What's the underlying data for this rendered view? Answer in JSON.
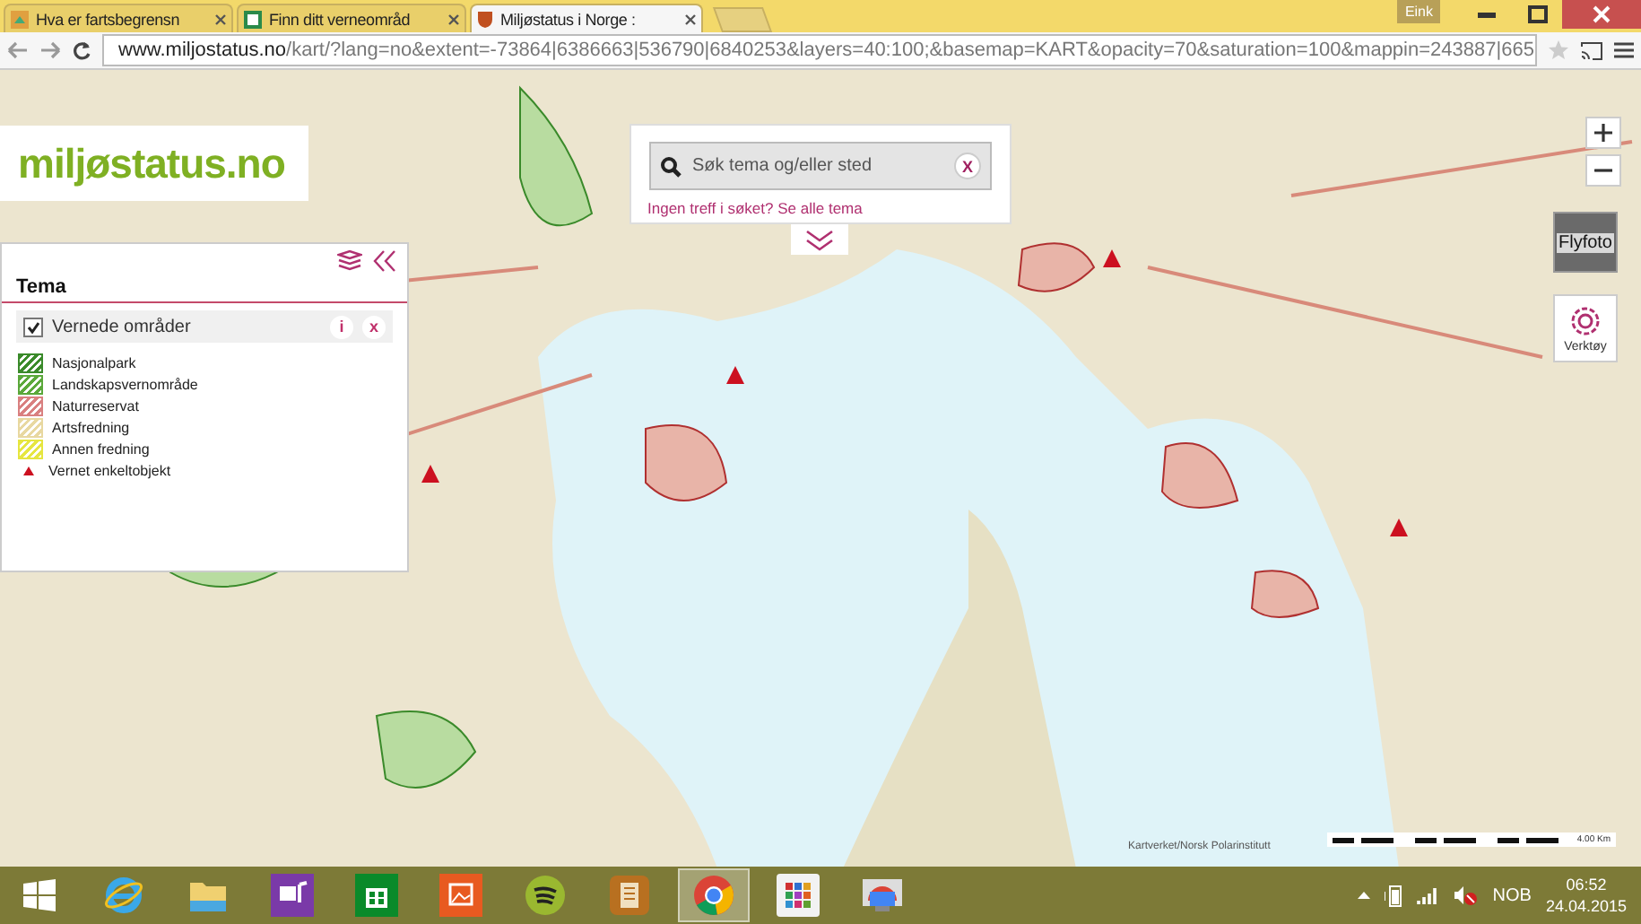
{
  "browser": {
    "tabs": [
      {
        "title": "Hva er fartsbegrensn",
        "selected": false,
        "kind": "map"
      },
      {
        "title": "Finn ditt verneområd",
        "selected": false,
        "kind": "green"
      },
      {
        "title": "Miljøstatus i Norge :",
        "selected": true,
        "kind": "shield"
      }
    ],
    "user": "Eink",
    "url_host": "www.miljostatus.no",
    "url_path": "/kart/?lang=no&extent=-73864|6386663|536790|6840253&layers=40:100;&basemap=KART&opacity=70&saturation=100&mappin=243887|665"
  },
  "logo": "miljøstatus.no",
  "tema_panel": {
    "title": "Tema",
    "layer": {
      "label": "Vernede områder",
      "checked": true,
      "info": "i",
      "remove": "x"
    },
    "legend": [
      {
        "label": "Nasjonalpark",
        "kind": "hatch",
        "color": "#3a8a2a"
      },
      {
        "label": "Landskapsvernområde",
        "kind": "hatch",
        "color": "#5aa83a"
      },
      {
        "label": "Naturreservat",
        "kind": "hatch",
        "color": "#d98080"
      },
      {
        "label": "Artsfredning",
        "kind": "hatch",
        "color": "#e8d8a0"
      },
      {
        "label": "Annen fredning",
        "kind": "hatch",
        "color": "#e6e640"
      },
      {
        "label": "Vernet enkeltobjekt",
        "kind": "triangle",
        "color": "#cc1020"
      }
    ]
  },
  "search": {
    "placeholder": "Søk tema og/eller sted",
    "clear": "X",
    "message": "Ingen treff i søket? Se alle tema"
  },
  "map_controls": {
    "flyfoto": "Flyfoto",
    "tools": "Verktøy",
    "attribution": "Kartverket/Norsk Polarinstitutt",
    "scale": "4.00 Km"
  },
  "taskbar": {
    "apps": [
      {
        "kind": "start",
        "selected": false
      },
      {
        "kind": "ie",
        "selected": false
      },
      {
        "kind": "folder",
        "selected": false
      },
      {
        "kind": "media",
        "selected": false
      },
      {
        "kind": "store",
        "selected": false
      },
      {
        "kind": "photos",
        "selected": false
      },
      {
        "kind": "music",
        "selected": false
      },
      {
        "kind": "reader",
        "selected": false
      },
      {
        "kind": "chrome",
        "selected": true
      },
      {
        "kind": "apps",
        "selected": false
      },
      {
        "kind": "remote",
        "selected": false
      }
    ],
    "language": "NOB",
    "time": "06:52",
    "date": "24.04.2015"
  }
}
